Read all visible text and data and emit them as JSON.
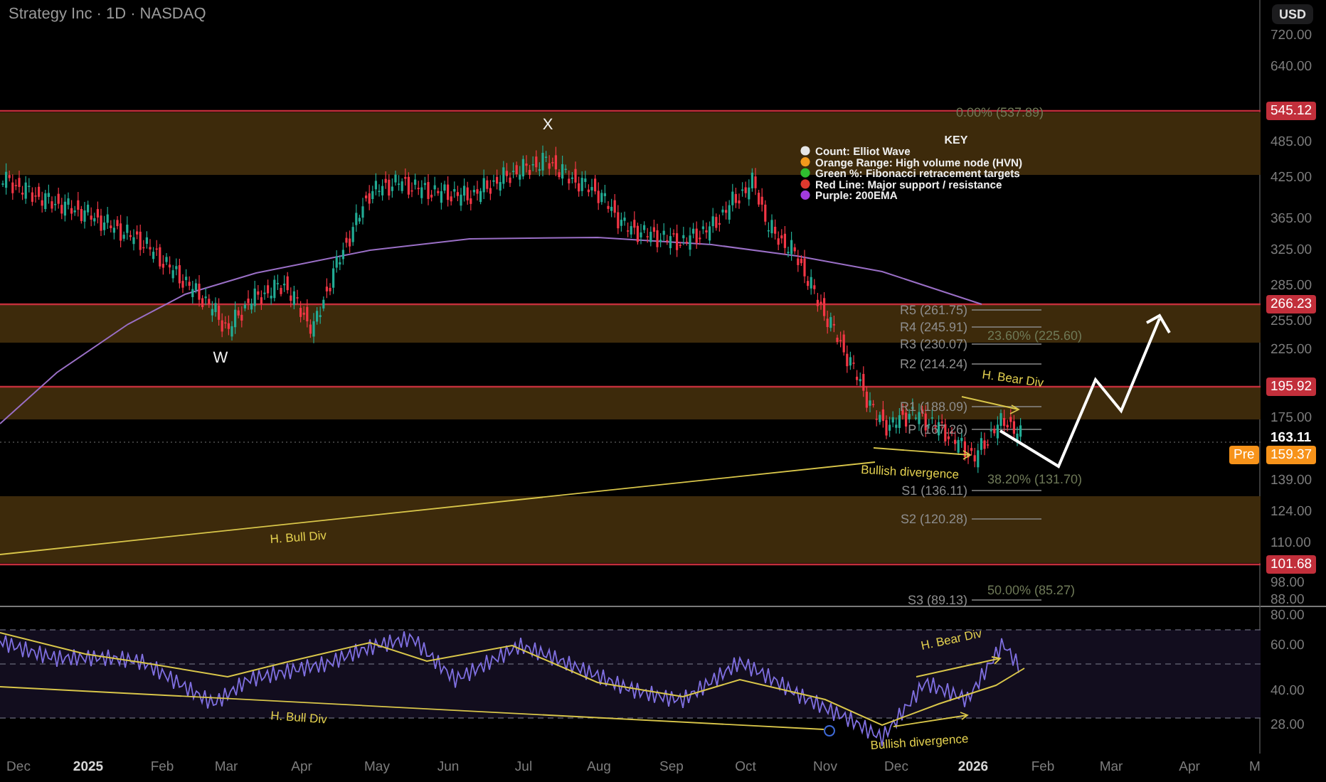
{
  "header": {
    "title": "Strategy Inc · 1D · NASDAQ",
    "currency": "USD"
  },
  "price_axis": [
    {
      "label": "720.00",
      "kind": "tick"
    },
    {
      "label": "640.00",
      "kind": "tick"
    },
    {
      "label": "545.12",
      "kind": "level"
    },
    {
      "label": "485.00",
      "kind": "tick"
    },
    {
      "label": "425.00",
      "kind": "tick"
    },
    {
      "label": "365.00",
      "kind": "tick"
    },
    {
      "label": "325.00",
      "kind": "tick"
    },
    {
      "label": "285.00",
      "kind": "tick"
    },
    {
      "label": "266.23",
      "kind": "level"
    },
    {
      "label": "255.00",
      "kind": "tick"
    },
    {
      "label": "225.00",
      "kind": "tick"
    },
    {
      "label": "195.92",
      "kind": "level"
    },
    {
      "label": "175.00",
      "kind": "tick"
    },
    {
      "label": "163.11",
      "kind": "last"
    },
    {
      "label": "159.37",
      "kind": "pre",
      "tag": "Pre"
    },
    {
      "label": "139.00",
      "kind": "tick"
    },
    {
      "label": "124.00",
      "kind": "tick"
    },
    {
      "label": "110.00",
      "kind": "tick"
    },
    {
      "label": "101.68",
      "kind": "level"
    },
    {
      "label": "98.00",
      "kind": "tick"
    },
    {
      "label": "88.00",
      "kind": "tick"
    }
  ],
  "price_pane": {
    "wave_labels": [
      "X",
      "W"
    ],
    "key": {
      "title": "KEY",
      "items": [
        {
          "label": "Count: Elliot Wave",
          "color": "#e6e6e6"
        },
        {
          "label": "Orange Range: High volume node (HVN)",
          "color": "#f29a1c"
        },
        {
          "label": "Green %: Fibonacci retracement targets",
          "color": "#2fbf2f"
        },
        {
          "label": "Red Line: Major support / resistance",
          "color": "#e0392e"
        },
        {
          "label": "Purple: 200EMA",
          "color": "#a23be0"
        }
      ]
    },
    "pivot_levels": [
      "R5 (261.75)",
      "R4 (245.91)",
      "R3 (230.07)",
      "R2 (214.24)",
      "R1 (188.09)",
      "P (167.26)",
      "S1 (136.11)",
      "S2 (120.28)",
      "S3 (89.13)"
    ],
    "fib_levels": [
      "0.00% (537.89)",
      "23.60% (225.60)",
      "38.20% (131.70)",
      "50.00% (85.27)"
    ],
    "divergences": [
      "H. Bear Div",
      "Bullish divergence",
      "H. Bull Div"
    ]
  },
  "rsi_pane": {
    "axis": [
      "80.00",
      "60.00",
      "40.00",
      "28.00"
    ],
    "divergences": [
      "H. Bull Div",
      "H. Bear Div",
      "Bullish divergence"
    ]
  },
  "time_axis": [
    {
      "label": "Dec",
      "kind": "month"
    },
    {
      "label": "2025",
      "kind": "year"
    },
    {
      "label": "Feb",
      "kind": "month"
    },
    {
      "label": "Mar",
      "kind": "month"
    },
    {
      "label": "Apr",
      "kind": "month"
    },
    {
      "label": "May",
      "kind": "month"
    },
    {
      "label": "Jun",
      "kind": "month"
    },
    {
      "label": "Jul",
      "kind": "month"
    },
    {
      "label": "Aug",
      "kind": "month"
    },
    {
      "label": "Sep",
      "kind": "month"
    },
    {
      "label": "Oct",
      "kind": "month"
    },
    {
      "label": "Nov",
      "kind": "month"
    },
    {
      "label": "Dec",
      "kind": "month"
    },
    {
      "label": "2026",
      "kind": "year"
    },
    {
      "label": "Feb",
      "kind": "month"
    },
    {
      "label": "Mar",
      "kind": "month"
    },
    {
      "label": "Apr",
      "kind": "month"
    },
    {
      "label": "M",
      "kind": "month"
    }
  ]
}
